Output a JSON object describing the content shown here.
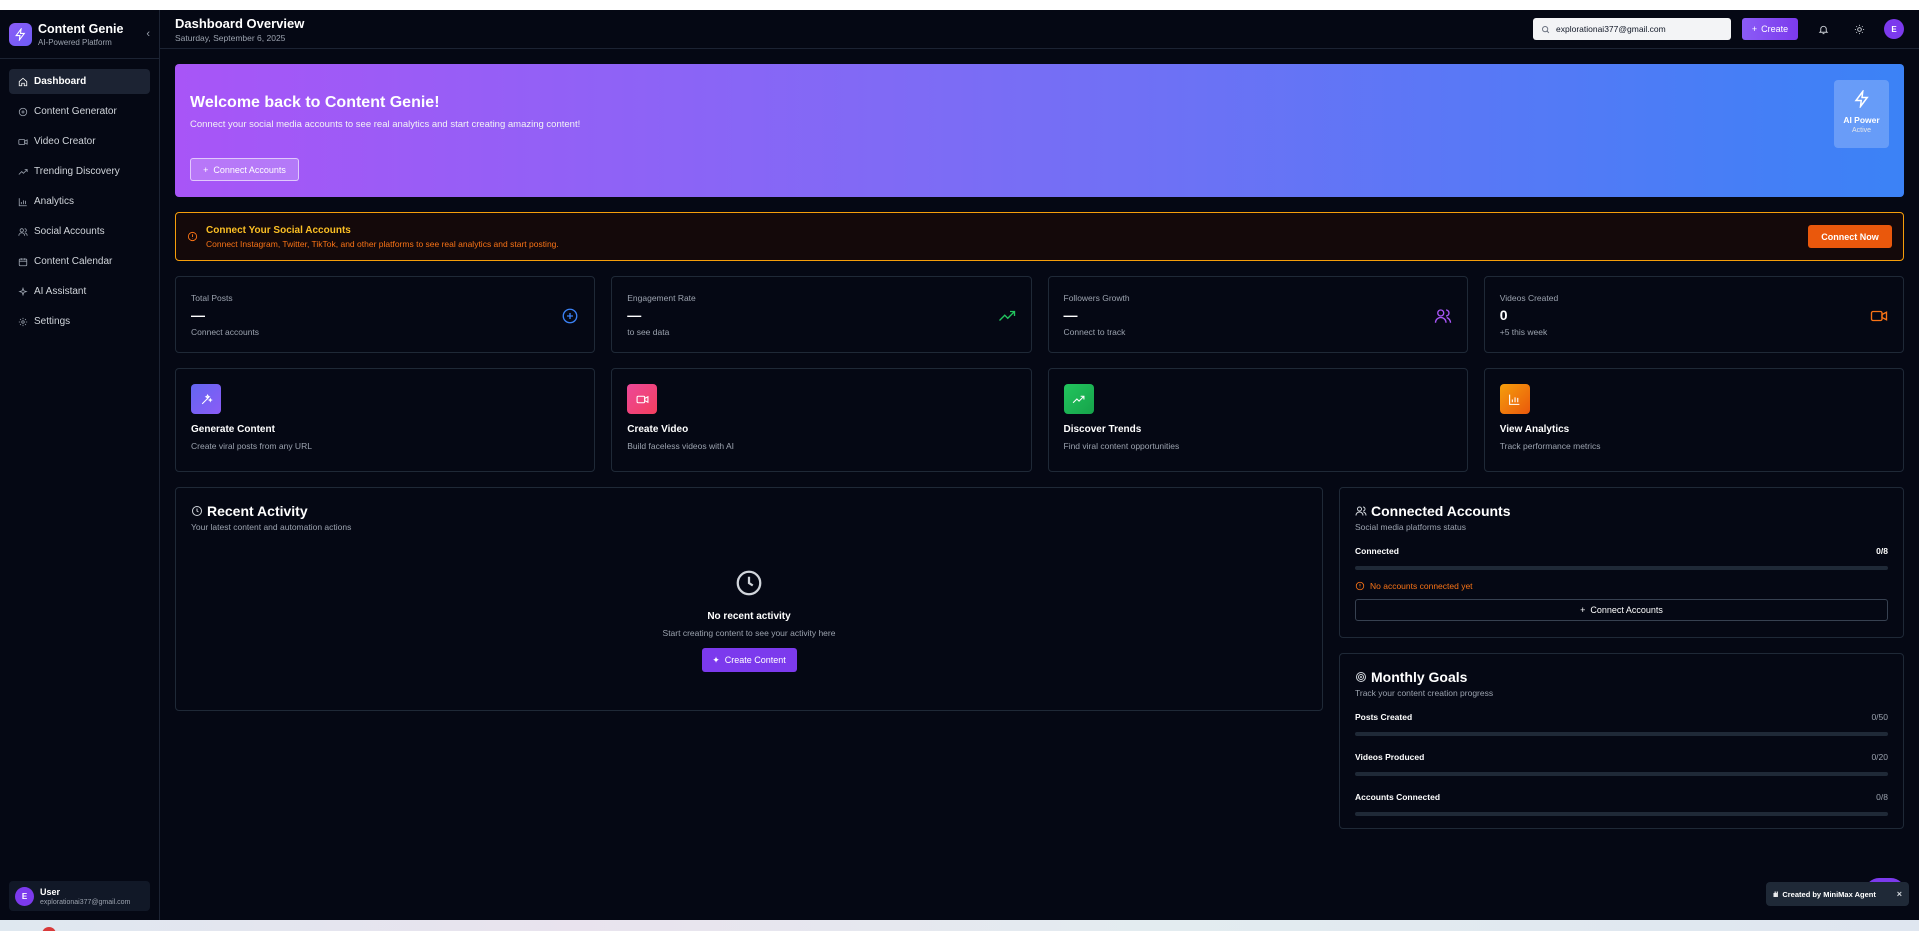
{
  "brand": {
    "title": "Content Genie",
    "subtitle": "AI-Powered Platform"
  },
  "nav": [
    {
      "label": "Dashboard",
      "icon": "home-icon",
      "active": true
    },
    {
      "label": "Content Generator",
      "icon": "plus-circle-icon"
    },
    {
      "label": "Video Creator",
      "icon": "video-icon"
    },
    {
      "label": "Trending Discovery",
      "icon": "trending-icon"
    },
    {
      "label": "Analytics",
      "icon": "bar-chart-icon"
    },
    {
      "label": "Social Accounts",
      "icon": "users-icon"
    },
    {
      "label": "Content Calendar",
      "icon": "calendar-icon"
    },
    {
      "label": "AI Assistant",
      "icon": "sparkle-icon"
    },
    {
      "label": "Settings",
      "icon": "gear-icon"
    }
  ],
  "user": {
    "initial": "E",
    "name": "User",
    "email": "explorationai377@gmail.com"
  },
  "header": {
    "title": "Dashboard Overview",
    "date": "Saturday, September 6, 2025",
    "search_value": "explorationai377@gmail.com",
    "create_label": "Create",
    "avatar_initial": "E"
  },
  "hero": {
    "title": "Welcome back to Content Genie!",
    "subtitle": "Connect your social media accounts to see real analytics and start creating amazing content!",
    "button": "Connect Accounts",
    "badge_title": "AI Power",
    "badge_sub": "Active"
  },
  "alert": {
    "title": "Connect Your Social Accounts",
    "subtitle": "Connect Instagram, Twitter, TikTok, and other platforms to see real analytics and start posting.",
    "button": "Connect Now"
  },
  "stats": [
    {
      "label": "Total Posts",
      "value": "—",
      "note": "Connect accounts",
      "icon": "plus-circle-icon",
      "color": "#3b82f6"
    },
    {
      "label": "Engagement Rate",
      "value": "—",
      "note": "to see data",
      "icon": "trending-icon",
      "color": "#22c55e"
    },
    {
      "label": "Followers Growth",
      "value": "—",
      "note": "Connect to track",
      "icon": "users-icon",
      "color": "#a855f7"
    },
    {
      "label": "Videos Created",
      "value": "0",
      "note": "+5 this week",
      "icon": "video-icon",
      "color": "#f97316"
    }
  ],
  "quick_actions": [
    {
      "title": "Generate Content",
      "subtitle": "Create viral posts from any URL",
      "icon": "wand-icon",
      "color": "#6366f1"
    },
    {
      "title": "Create Video",
      "subtitle": "Build faceless videos with AI",
      "icon": "video-icon",
      "color": "#ec4899"
    },
    {
      "title": "Discover Trends",
      "subtitle": "Find viral content opportunities",
      "icon": "trending-icon",
      "color": "#22c55e"
    },
    {
      "title": "View Analytics",
      "subtitle": "Track performance metrics",
      "icon": "bar-chart-icon",
      "color": "#f59e0b"
    }
  ],
  "activity": {
    "title": "Recent Activity",
    "subtitle": "Your latest content and automation actions",
    "empty_title": "No recent activity",
    "empty_sub": "Start creating content to see your activity here",
    "button": "Create Content"
  },
  "connected": {
    "title": "Connected Accounts",
    "subtitle": "Social media platforms status",
    "row_label": "Connected",
    "row_value": "0/8",
    "progress": 0,
    "warning": "No accounts connected yet",
    "button": "Connect Accounts"
  },
  "goals": {
    "title": "Monthly Goals",
    "subtitle": "Track your content creation progress",
    "items": [
      {
        "label": "Posts Created",
        "value": "0/50",
        "progress": 0
      },
      {
        "label": "Videos Produced",
        "value": "0/20",
        "progress": 0
      },
      {
        "label": "Accounts Connected",
        "value": "0/8",
        "progress": 0
      }
    ]
  },
  "footer": {
    "badge": "Created by MiniMax Agent",
    "close": "×"
  }
}
